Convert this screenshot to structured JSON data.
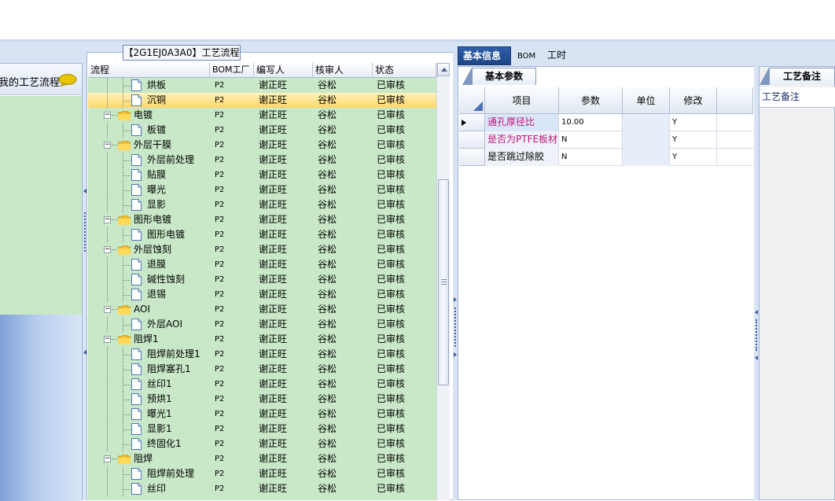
{
  "left_nav": {
    "item_label": "我的工艺流程"
  },
  "flow_panel": {
    "title": "【2G1EJ0A3A0】工艺流程",
    "columns": [
      "流程",
      "BOM工厂",
      "编写人",
      "核审人",
      "状态"
    ],
    "rows": [
      {
        "name": "烘板",
        "bom": "P2",
        "writer": "谢正旺",
        "reviewer": "谷松",
        "status": "已审核",
        "level": 1,
        "type": "doc"
      },
      {
        "name": "沉铜",
        "bom": "P2",
        "writer": "谢正旺",
        "reviewer": "谷松",
        "status": "已审核",
        "level": 1,
        "type": "doc",
        "selected": true
      },
      {
        "name": "电镀",
        "bom": "P2",
        "writer": "谢正旺",
        "reviewer": "谷松",
        "status": "已审核",
        "level": 0,
        "type": "folder"
      },
      {
        "name": "板镀",
        "bom": "P2",
        "writer": "谢正旺",
        "reviewer": "谷松",
        "status": "已审核",
        "level": 1,
        "type": "doc"
      },
      {
        "name": "外层干膜",
        "bom": "P2",
        "writer": "谢正旺",
        "reviewer": "谷松",
        "status": "已审核",
        "level": 0,
        "type": "folder"
      },
      {
        "name": "外层前处理",
        "bom": "P2",
        "writer": "谢正旺",
        "reviewer": "谷松",
        "status": "已审核",
        "level": 1,
        "type": "doc"
      },
      {
        "name": "贴膜",
        "bom": "P2",
        "writer": "谢正旺",
        "reviewer": "谷松",
        "status": "已审核",
        "level": 1,
        "type": "doc"
      },
      {
        "name": "曝光",
        "bom": "P2",
        "writer": "谢正旺",
        "reviewer": "谷松",
        "status": "已审核",
        "level": 1,
        "type": "doc"
      },
      {
        "name": "显影",
        "bom": "P2",
        "writer": "谢正旺",
        "reviewer": "谷松",
        "status": "已审核",
        "level": 1,
        "type": "doc"
      },
      {
        "name": "图形电镀",
        "bom": "P2",
        "writer": "谢正旺",
        "reviewer": "谷松",
        "status": "已审核",
        "level": 0,
        "type": "folder"
      },
      {
        "name": "图形电镀",
        "bom": "P2",
        "writer": "谢正旺",
        "reviewer": "谷松",
        "status": "已审核",
        "level": 1,
        "type": "doc"
      },
      {
        "name": "外层蚀刻",
        "bom": "P2",
        "writer": "谢正旺",
        "reviewer": "谷松",
        "status": "已审核",
        "level": 0,
        "type": "folder"
      },
      {
        "name": "退膜",
        "bom": "P2",
        "writer": "谢正旺",
        "reviewer": "谷松",
        "status": "已审核",
        "level": 1,
        "type": "doc"
      },
      {
        "name": "碱性蚀刻",
        "bom": "P2",
        "writer": "谢正旺",
        "reviewer": "谷松",
        "status": "已审核",
        "level": 1,
        "type": "doc"
      },
      {
        "name": "退锡",
        "bom": "P2",
        "writer": "谢正旺",
        "reviewer": "谷松",
        "status": "已审核",
        "level": 1,
        "type": "doc"
      },
      {
        "name": "AOI",
        "bom": "P2",
        "writer": "谢正旺",
        "reviewer": "谷松",
        "status": "已审核",
        "level": 0,
        "type": "folder"
      },
      {
        "name": "外层AOI",
        "bom": "P2",
        "writer": "谢正旺",
        "reviewer": "谷松",
        "status": "已审核",
        "level": 1,
        "type": "doc"
      },
      {
        "name": "阻焊1",
        "bom": "P2",
        "writer": "谢正旺",
        "reviewer": "谷松",
        "status": "已审核",
        "level": 0,
        "type": "folder"
      },
      {
        "name": "阻焊前处理1",
        "bom": "P2",
        "writer": "谢正旺",
        "reviewer": "谷松",
        "status": "已审核",
        "level": 1,
        "type": "doc"
      },
      {
        "name": "阻焊塞孔1",
        "bom": "P2",
        "writer": "谢正旺",
        "reviewer": "谷松",
        "status": "已审核",
        "level": 1,
        "type": "doc"
      },
      {
        "name": "丝印1",
        "bom": "P2",
        "writer": "谢正旺",
        "reviewer": "谷松",
        "status": "已审核",
        "level": 1,
        "type": "doc"
      },
      {
        "name": "预烘1",
        "bom": "P2",
        "writer": "谢正旺",
        "reviewer": "谷松",
        "status": "已审核",
        "level": 1,
        "type": "doc"
      },
      {
        "name": "曝光1",
        "bom": "P2",
        "writer": "谢正旺",
        "reviewer": "谷松",
        "status": "已审核",
        "level": 1,
        "type": "doc"
      },
      {
        "name": "显影1",
        "bom": "P2",
        "writer": "谢正旺",
        "reviewer": "谷松",
        "status": "已审核",
        "level": 1,
        "type": "doc"
      },
      {
        "name": "终固化1",
        "bom": "P2",
        "writer": "谢正旺",
        "reviewer": "谷松",
        "status": "已审核",
        "level": 1,
        "type": "doc"
      },
      {
        "name": "阻焊",
        "bom": "P2",
        "writer": "谢正旺",
        "reviewer": "谷松",
        "status": "已审核",
        "level": 0,
        "type": "folder"
      },
      {
        "name": "阻焊前处理",
        "bom": "P2",
        "writer": "谢正旺",
        "reviewer": "谷松",
        "status": "已审核",
        "level": 1,
        "type": "doc"
      },
      {
        "name": "丝印",
        "bom": "P2",
        "writer": "谢正旺",
        "reviewer": "谷松",
        "status": "已审核",
        "level": 1,
        "type": "doc"
      }
    ]
  },
  "main_tabs": [
    "基本信息",
    "BOM",
    "工时"
  ],
  "params": {
    "tab_label": "基本参数",
    "columns": [
      "项目",
      "参数",
      "单位",
      "修改"
    ],
    "rows": [
      {
        "item": "通孔厚径比",
        "value": "10.00",
        "unit": "",
        "modify": "Y"
      },
      {
        "item": "是否为PTFE板材",
        "value": "N",
        "unit": "",
        "modify": "Y"
      },
      {
        "item": "是否跳过除胶",
        "value": "N",
        "unit": "",
        "modify": "Y"
      }
    ]
  },
  "notes": {
    "tab_label": "工艺备注",
    "field_label": "工艺备注"
  },
  "colors": {
    "grid_bg": "#c8e8c8",
    "selected_row": "#ffd76a",
    "tab_active": "#1d4487",
    "pink_text": "#c0147a"
  }
}
